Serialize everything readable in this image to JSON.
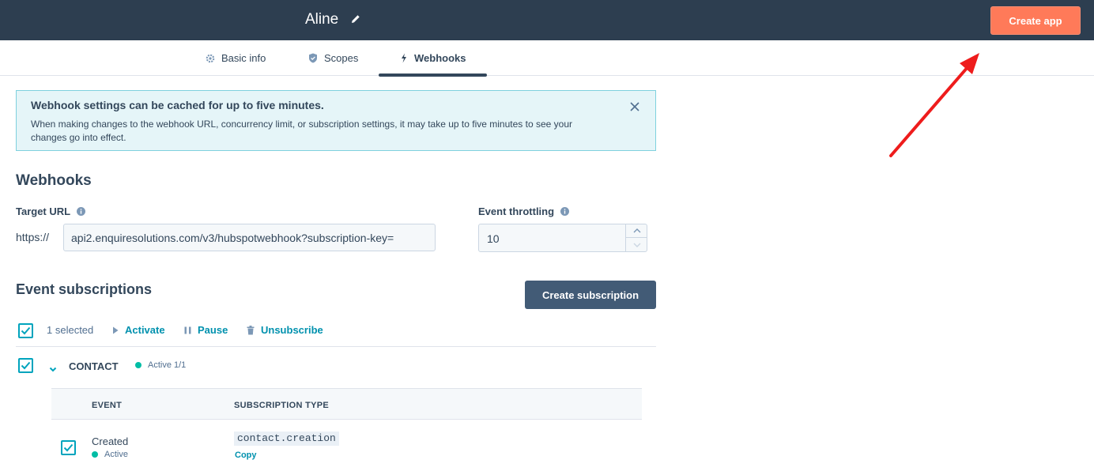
{
  "header": {
    "app_name": "Aline",
    "create_app_label": "Create app",
    "accent_color": "#ff7a59"
  },
  "tabs": [
    {
      "label": "Basic info",
      "icon": "gear-icon"
    },
    {
      "label": "Scopes",
      "icon": "shield-icon"
    },
    {
      "label": "Webhooks",
      "icon": "lightning-icon",
      "active": true
    }
  ],
  "alert": {
    "title": "Webhook settings can be cached for up to five minutes.",
    "body": "When making changes to the webhook URL, concurrency limit, or subscription settings, it may take up to five minutes to see your changes go into effect."
  },
  "webhooks": {
    "heading": "Webhooks",
    "target_url_label": "Target URL",
    "url_prefix": "https://",
    "url_value": "api2.enquiresolutions.com/v3/hubspotwebhook?subscription-key=",
    "throttling_label": "Event throttling",
    "throttling_value": "10"
  },
  "subscriptions": {
    "heading": "Event subscriptions",
    "create_label": "Create subscription",
    "selected_text": "1 selected",
    "activate_label": "Activate",
    "pause_label": "Pause",
    "unsubscribe_label": "Unsubscribe",
    "object_name": "CONTACT",
    "object_status": "Active 1/1",
    "columns": [
      "EVENT",
      "SUBSCRIPTION TYPE"
    ],
    "rows": [
      {
        "event": "Created",
        "status": "Active",
        "type": "contact.creation",
        "copy_label": "Copy"
      }
    ]
  }
}
